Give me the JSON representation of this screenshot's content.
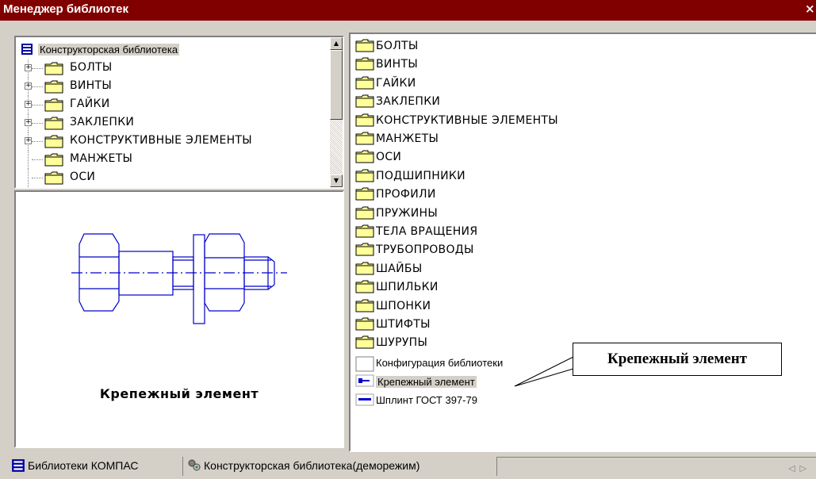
{
  "window": {
    "title": "Менеджер библиотек",
    "close_glyph": "×"
  },
  "tree": {
    "root_label": "Конструкторская библиотека",
    "root_icon": "library-book-icon",
    "items": [
      {
        "label": "БОЛТЫ",
        "expandable": true
      },
      {
        "label": "ВИНТЫ",
        "expandable": true
      },
      {
        "label": "ГАЙКИ",
        "expandable": true
      },
      {
        "label": "ЗАКЛЕПКИ",
        "expandable": true
      },
      {
        "label": "КОНСТРУКТИВНЫЕ ЭЛЕМЕНТЫ",
        "expandable": true
      },
      {
        "label": "МАНЖЕТЫ",
        "expandable": false
      },
      {
        "label": "ОСИ",
        "expandable": false
      }
    ]
  },
  "preview": {
    "caption": "Крепежный элемент"
  },
  "list": {
    "folders": [
      "БОЛТЫ",
      "ВИНТЫ",
      "ГАЙКИ",
      "ЗАКЛЕПКИ",
      "КОНСТРУКТИВНЫЕ ЭЛЕМЕНТЫ",
      "МАНЖЕТЫ",
      "ОСИ",
      "ПОДШИПНИКИ",
      "ПРОФИЛИ",
      "ПРУЖИНЫ",
      "ТЕЛА ВРАЩЕНИЯ",
      "ТРУБОПРОВОДЫ",
      "ШАЙБЫ",
      "ШПИЛЬКИ",
      "ШПОНКИ",
      "ШТИФТЫ",
      "ШУРУПЫ"
    ],
    "items": [
      {
        "label": "Конфигурация библиотеки",
        "icon": "blank-document-icon"
      },
      {
        "label": "Крепежный элемент",
        "icon": "fastener-icon",
        "selected": true
      },
      {
        "label": "Шплинт ГОСТ 397-79",
        "icon": "cotter-pin-icon"
      }
    ]
  },
  "callout": {
    "text": "Крепежный элемент"
  },
  "tabs": [
    {
      "label": "Библиотеки КОМПАС",
      "icon": "library-icon",
      "active": true
    },
    {
      "label": "Конструкторская библиотека(деморежим)",
      "icon": "gear-cluster-icon",
      "active": false
    }
  ],
  "colors": {
    "titlebar": "#800000",
    "folder": "#ffff99",
    "drawing": "#0000cc",
    "face": "#d4d0c8"
  }
}
